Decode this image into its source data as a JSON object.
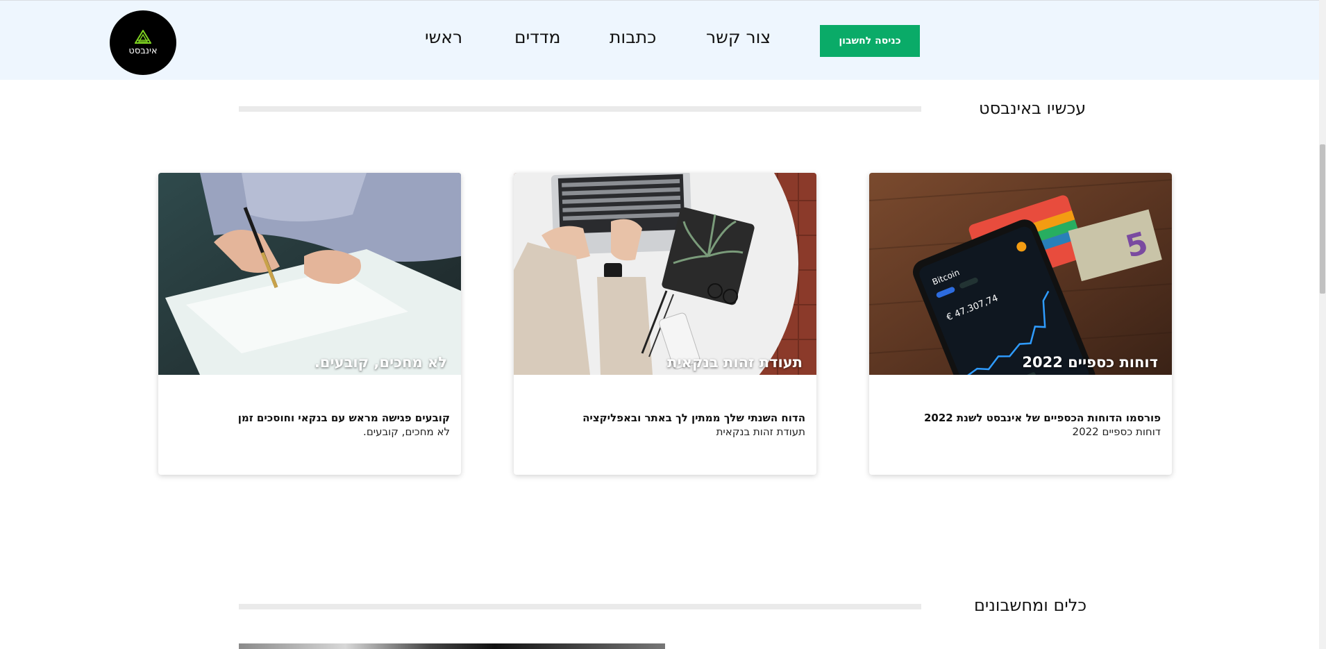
{
  "header": {
    "logo_text": "אינבסט",
    "nav": [
      "ראשי",
      "מדדים",
      "כתבות",
      "צור קשר"
    ],
    "login_button": "כניסה לחשבון"
  },
  "sections": {
    "now": {
      "title": "עכשיו באינבסט"
    },
    "tools": {
      "title": "כלים ומחשבונים"
    }
  },
  "cards": [
    {
      "image_caption": "דוחות כספיים 2022",
      "title": "פורסמו הדוחות הכספיים של אינבסט לשנת 2022",
      "subtitle": "דוחות כספיים 2022"
    },
    {
      "image_caption": "תעודת זהות בנקאית",
      "title": "הדוח השנתי שלך ממתין לך באתר ובאפליקציה",
      "subtitle": "תעודת זהות בנקאית"
    },
    {
      "image_caption": "לא מחכים, קובעים.",
      "title": "קובעים פגישה מראש עם בנקאי וחוסכים זמן",
      "subtitle": "לא מחכים, קובעים."
    }
  ],
  "colors": {
    "header_bg": "#eef6fe",
    "accent_green": "#0aab68",
    "logo_bg": "#000000"
  },
  "icons": [
    "logo-triangle-icon",
    "phone-chart-image",
    "laptop-desk-image",
    "signing-document-image"
  ]
}
